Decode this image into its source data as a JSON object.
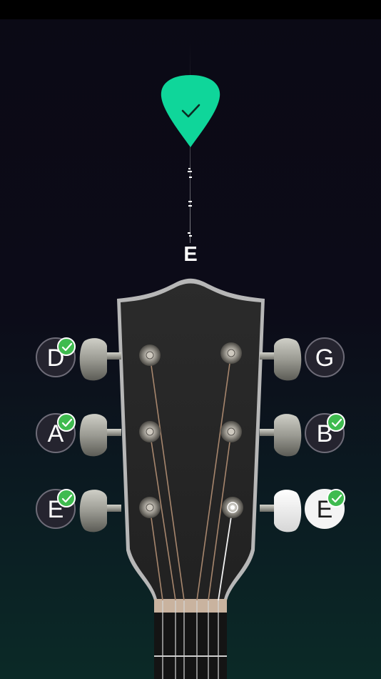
{
  "tuner": {
    "current_note": "E",
    "pick_color": "#0fd69a",
    "pick_icon": "checkmark-icon"
  },
  "strings": [
    {
      "id": "D",
      "label": "D",
      "side": "left",
      "tuned": true,
      "active": false
    },
    {
      "id": "A",
      "label": "A",
      "side": "left",
      "tuned": true,
      "active": false
    },
    {
      "id": "E_low",
      "label": "E",
      "side": "left",
      "tuned": true,
      "active": false
    },
    {
      "id": "G",
      "label": "G",
      "side": "right",
      "tuned": false,
      "active": false
    },
    {
      "id": "B",
      "label": "B",
      "side": "right",
      "tuned": true,
      "active": false
    },
    {
      "id": "E_high",
      "label": "E",
      "side": "right",
      "tuned": true,
      "active": true
    }
  ],
  "colors": {
    "tuned_badge": "#3fbb4f",
    "peg_button": "#25242f",
    "active_peg": "#f4f4f4"
  }
}
